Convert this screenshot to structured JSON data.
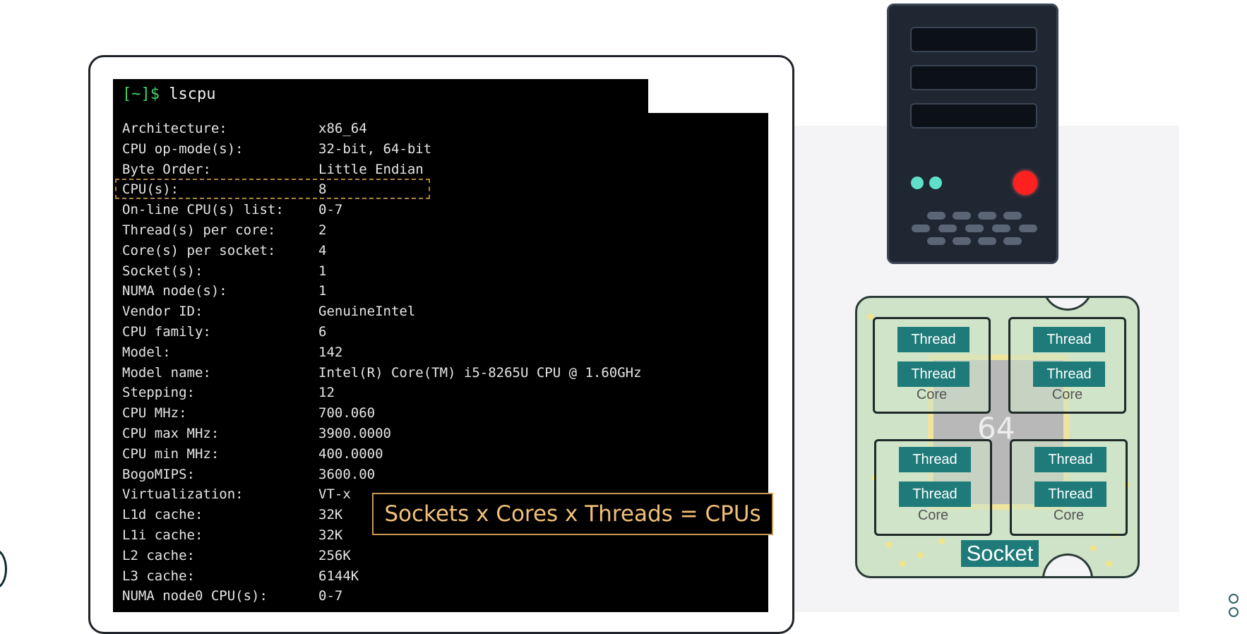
{
  "terminal": {
    "prompt": "[~]$",
    "command": "lscpu",
    "rows": [
      {
        "key": "Architecture:",
        "value": "x86_64"
      },
      {
        "key": "CPU op-mode(s):",
        "value": "32-bit, 64-bit"
      },
      {
        "key": "Byte Order:",
        "value": "Little Endian"
      },
      {
        "key": "CPU(s):",
        "value": "8"
      },
      {
        "key": "On-line CPU(s) list:",
        "value": "0-7"
      },
      {
        "key": "Thread(s) per core:",
        "value": "2"
      },
      {
        "key": "Core(s) per socket:",
        "value": "4"
      },
      {
        "key": "Socket(s):",
        "value": "1"
      },
      {
        "key": "NUMA node(s):",
        "value": "1"
      },
      {
        "key": "Vendor ID:",
        "value": "GenuineIntel"
      },
      {
        "key": "CPU family:",
        "value": "6"
      },
      {
        "key": "Model:",
        "value": "142"
      },
      {
        "key": "Model name:",
        "value": "Intel(R) Core(TM) i5-8265U CPU @ 1.60GHz"
      },
      {
        "key": "Stepping:",
        "value": "12"
      },
      {
        "key": "CPU MHz:",
        "value": "700.060"
      },
      {
        "key": "CPU max MHz:",
        "value": "3900.0000"
      },
      {
        "key": "CPU min MHz:",
        "value": "400.0000"
      },
      {
        "key": "BogoMIPS:",
        "value": "3600.00"
      },
      {
        "key": "Virtualization:",
        "value": "VT-x"
      },
      {
        "key": "L1d cache:",
        "value": "32K"
      },
      {
        "key": "L1i cache:",
        "value": "32K"
      },
      {
        "key": "L2 cache:",
        "value": "256K"
      },
      {
        "key": "L3 cache:",
        "value": "6144K"
      },
      {
        "key": "NUMA node0 CPU(s):",
        "value": "0-7"
      }
    ],
    "formula": "Sockets x Cores x Threads = CPUs"
  },
  "diagram": {
    "thread_label": "Thread",
    "core_label": "Core",
    "socket_label": "Socket",
    "chip_number": "64"
  },
  "colors": {
    "terminal_bg": "#000000",
    "prompt_green": "#3fd26b",
    "highlight_orange": "#c89a53",
    "thread_teal": "#1e7b79",
    "server_body": "#1f2733",
    "server_led_red": "#ff2020",
    "server_led_teal": "#5fe0c8"
  }
}
